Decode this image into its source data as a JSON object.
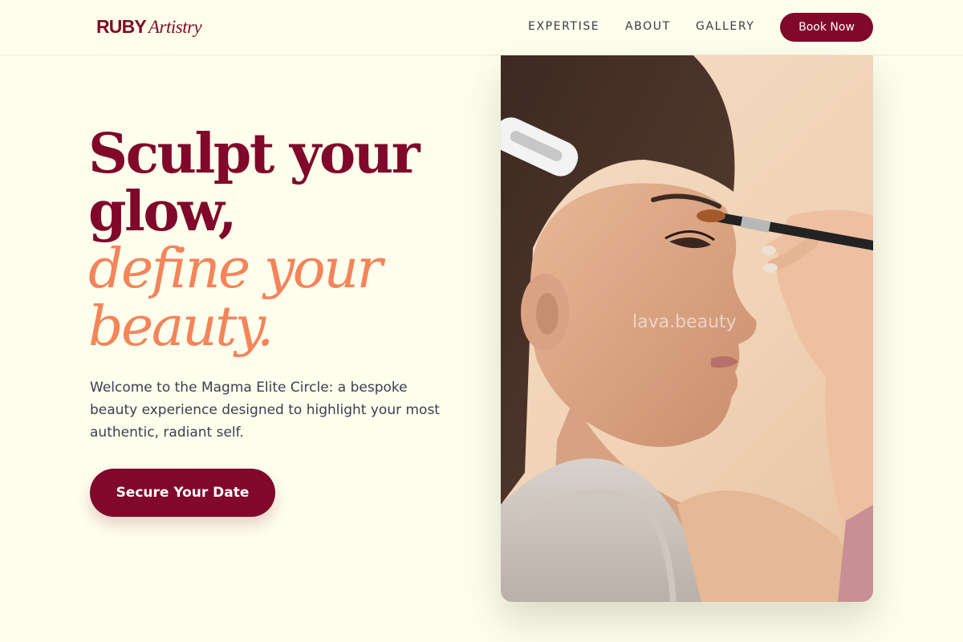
{
  "brand": {
    "name": "RUBY",
    "script": "Artistry"
  },
  "nav": {
    "items": [
      "EXPERTISE",
      "ABOUT",
      "GALLERY"
    ],
    "book_label": "Book Now"
  },
  "hero": {
    "headline_line1": "Sculpt your",
    "headline_line2": "glow,",
    "accent_line1": "define your",
    "accent_line2": "beauty.",
    "intro": "Welcome to the Magma Elite Circle: a bespoke beauty experience designed to highlight your most authentic, radiant self.",
    "cta_label": "Secure Your Date",
    "image_watermark": "lava.beauty"
  },
  "colors": {
    "background": "#fefeed",
    "primary": "#80082a",
    "accent": "#f4845a",
    "text": "#3a3f4f"
  }
}
